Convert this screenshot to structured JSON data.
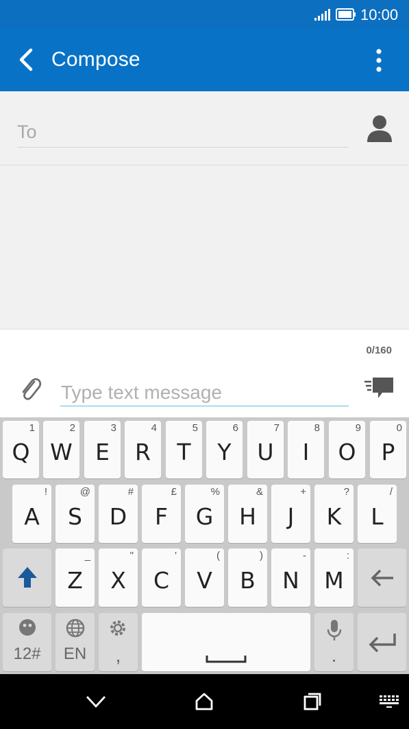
{
  "status": {
    "time": "10:00"
  },
  "header": {
    "title": "Compose"
  },
  "recipient": {
    "placeholder": "To"
  },
  "compose": {
    "char_count": "0/160",
    "placeholder": "Type text message"
  },
  "keyboard": {
    "row1": [
      {
        "key": "Q",
        "alt": "1"
      },
      {
        "key": "W",
        "alt": "2"
      },
      {
        "key": "E",
        "alt": "3"
      },
      {
        "key": "R",
        "alt": "4"
      },
      {
        "key": "T",
        "alt": "5"
      },
      {
        "key": "Y",
        "alt": "6"
      },
      {
        "key": "U",
        "alt": "7"
      },
      {
        "key": "I",
        "alt": "8"
      },
      {
        "key": "O",
        "alt": "9"
      },
      {
        "key": "P",
        "alt": "0"
      }
    ],
    "row2": [
      {
        "key": "A",
        "alt": "!"
      },
      {
        "key": "S",
        "alt": "@"
      },
      {
        "key": "D",
        "alt": "#"
      },
      {
        "key": "F",
        "alt": "£"
      },
      {
        "key": "G",
        "alt": "%"
      },
      {
        "key": "H",
        "alt": "&"
      },
      {
        "key": "J",
        "alt": "+"
      },
      {
        "key": "K",
        "alt": "?"
      },
      {
        "key": "L",
        "alt": "/"
      }
    ],
    "row3": [
      {
        "key": "Z",
        "alt": "_"
      },
      {
        "key": "X",
        "alt": "\""
      },
      {
        "key": "C",
        "alt": "'"
      },
      {
        "key": "V",
        "alt": "("
      },
      {
        "key": "B",
        "alt": ")"
      },
      {
        "key": "N",
        "alt": "-"
      },
      {
        "key": "M",
        "alt": ":"
      }
    ],
    "symbols_label": "12#",
    "language_label": "EN",
    "comma_label": ",",
    "period_label": "."
  },
  "colors": {
    "status_bar": "#0c6fc0",
    "action_bar": "#0873c6",
    "accent": "#5bc2d9",
    "shift": "#1a5a9c"
  },
  "icons": [
    "back-arrow-icon",
    "overflow-menu-icon",
    "contact-icon",
    "paperclip-icon",
    "send-icon",
    "shift-icon",
    "backspace-icon",
    "emoji-icon",
    "globe-icon",
    "gear-icon",
    "microphone-icon",
    "enter-icon",
    "nav-back-icon",
    "nav-home-icon",
    "nav-recents-icon",
    "keyboard-icon",
    "signal-icon",
    "battery-icon"
  ]
}
